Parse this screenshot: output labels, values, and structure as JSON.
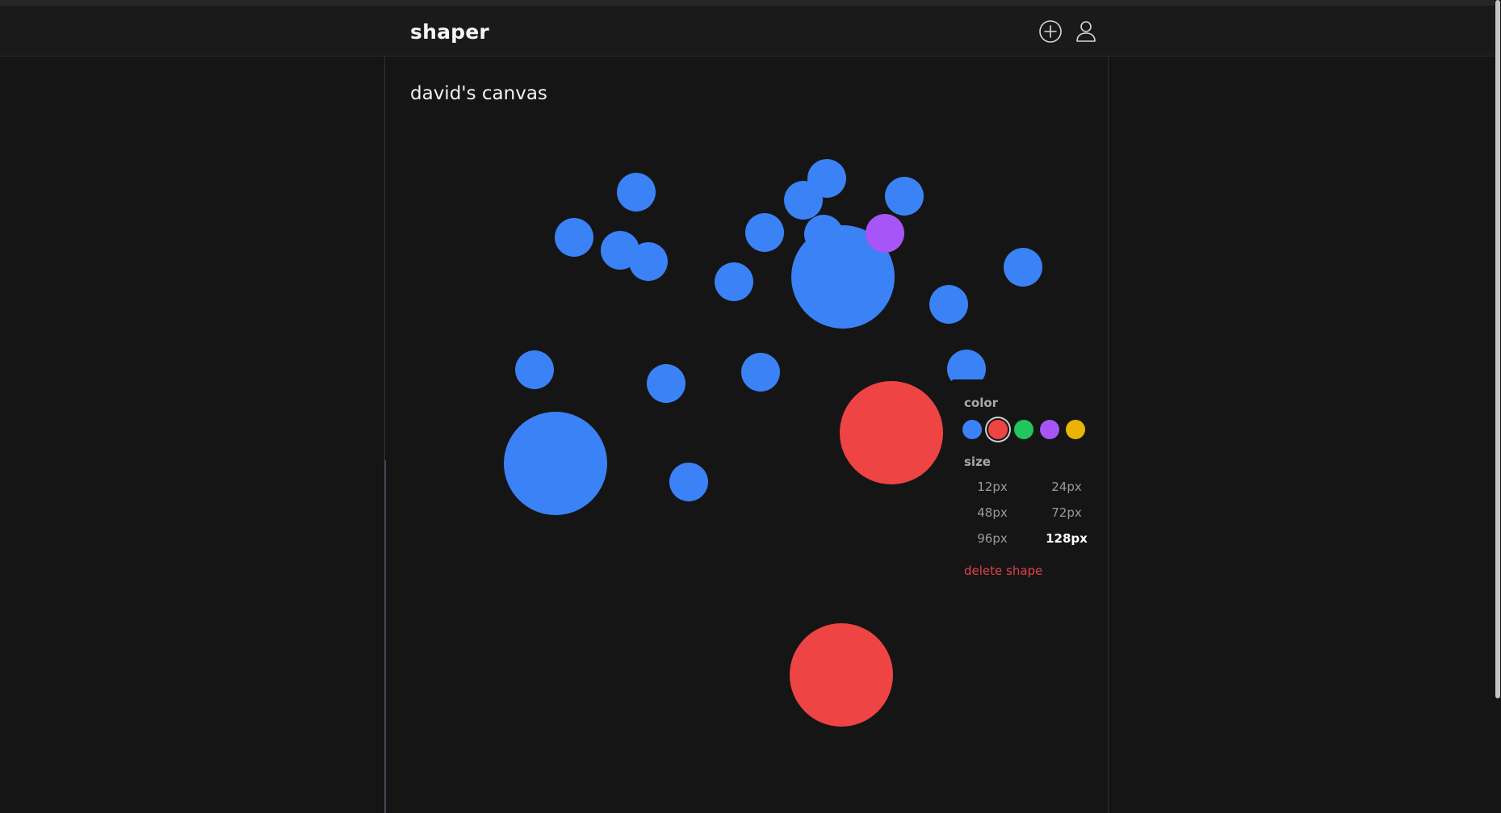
{
  "app": {
    "brand": "shaper"
  },
  "header": {
    "add_icon": "plus-circle-icon",
    "user_icon": "user-icon"
  },
  "canvas": {
    "title": "david's canvas",
    "colors": {
      "blue": "#3b82f6",
      "red": "#ef4444",
      "green": "#22c55e",
      "purple": "#a855f7",
      "yellow": "#eab308"
    },
    "shapes": [
      {
        "color": "blue",
        "size": 48
      },
      {
        "color": "blue",
        "size": 48
      },
      {
        "color": "blue",
        "size": 48
      },
      {
        "color": "blue",
        "size": 48
      },
      {
        "color": "blue",
        "size": 48
      },
      {
        "color": "blue",
        "size": 48
      },
      {
        "color": "blue",
        "size": 48
      },
      {
        "color": "blue",
        "size": 48
      },
      {
        "color": "blue",
        "size": 48
      },
      {
        "color": "blue",
        "size": 48
      },
      {
        "color": "blue",
        "size": 128
      },
      {
        "color": "purple",
        "size": 48
      },
      {
        "color": "blue",
        "size": 48
      },
      {
        "color": "blue",
        "size": 48
      },
      {
        "color": "blue",
        "size": 48
      },
      {
        "color": "blue",
        "size": 48
      },
      {
        "color": "blue",
        "size": 48
      },
      {
        "color": "blue",
        "size": 48
      },
      {
        "color": "blue",
        "size": 128
      },
      {
        "color": "blue",
        "size": 48
      },
      {
        "color": "red",
        "size": 128
      },
      {
        "color": "red",
        "size": 128
      }
    ]
  },
  "popover": {
    "color_label": "color",
    "size_label": "size",
    "colors": [
      "blue",
      "red",
      "green",
      "purple",
      "yellow"
    ],
    "selected_color": "red",
    "sizes": [
      "12px",
      "24px",
      "48px",
      "72px",
      "96px",
      "128px"
    ],
    "selected_size": "128px",
    "delete_label": "delete shape"
  }
}
